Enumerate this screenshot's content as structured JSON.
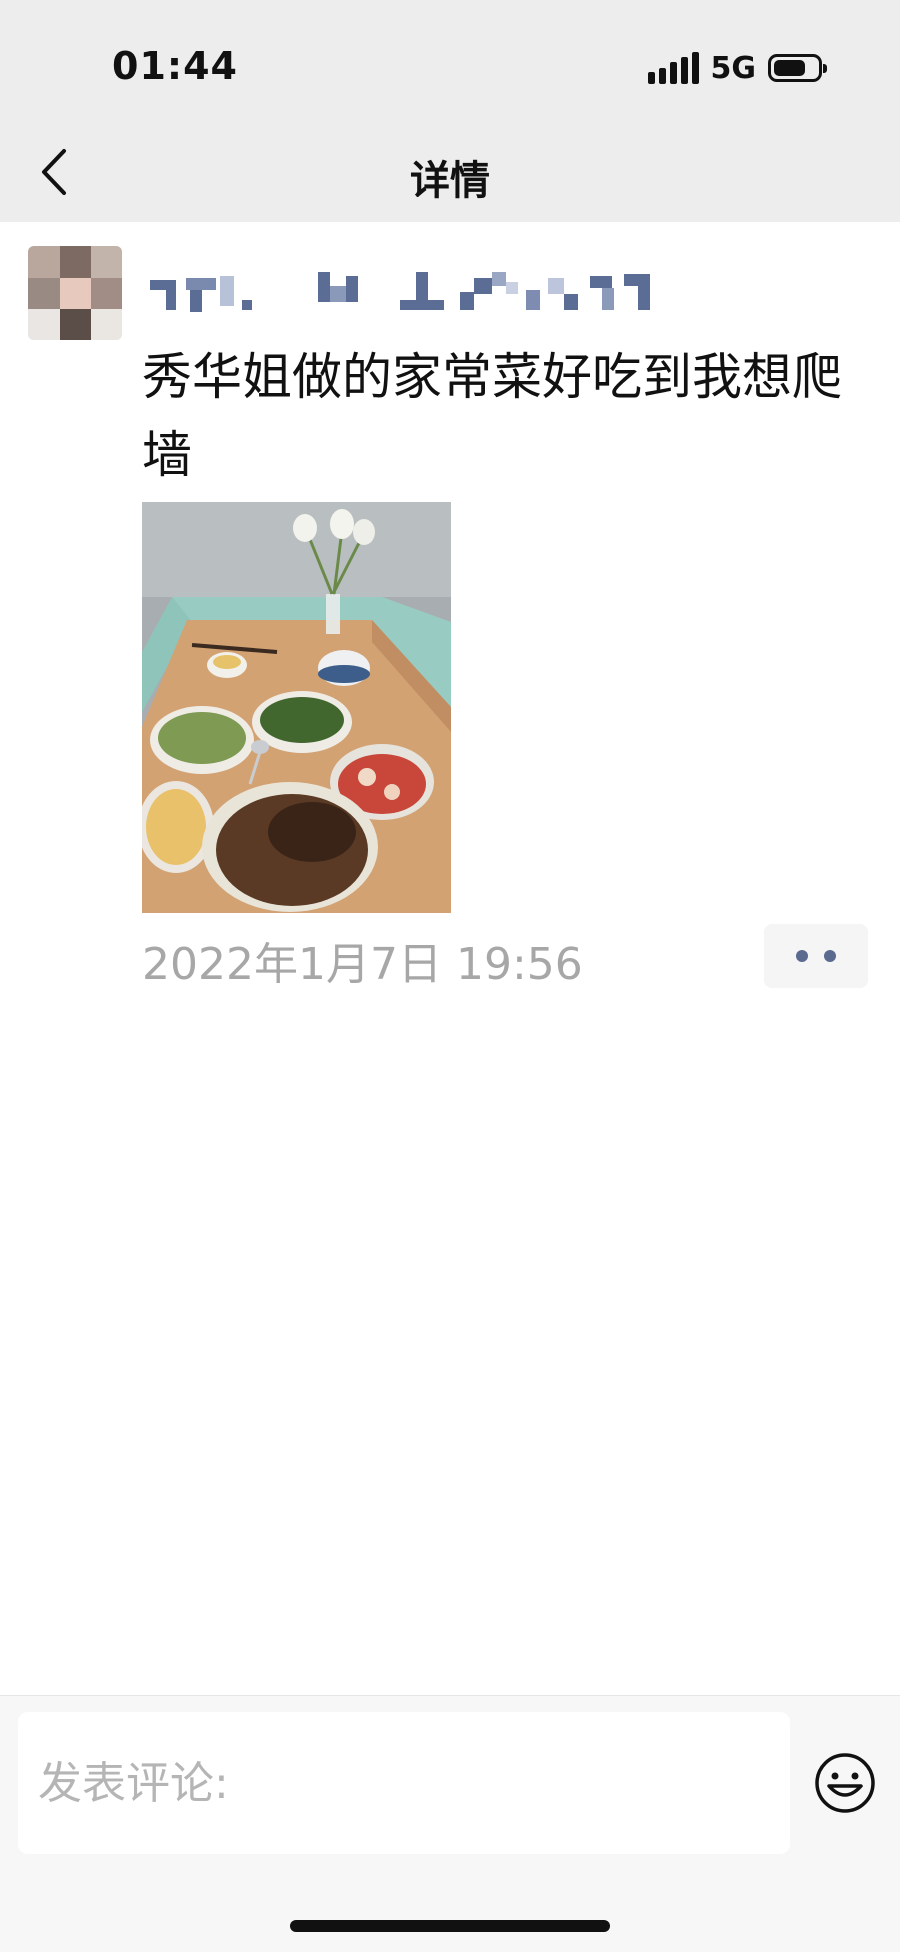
{
  "status_bar": {
    "time": "01:44",
    "network": "5G"
  },
  "nav": {
    "title": "详情"
  },
  "post": {
    "text": "秀华姐做的家常菜好吃到我想爬墙",
    "timestamp": "2022年1月7日 19:56"
  },
  "icons": {
    "back": "chevron-left-icon",
    "more": "more-dots-icon",
    "emoji": "smiley-face-icon",
    "signal": "signal-bars-icon",
    "battery": "battery-icon"
  },
  "comment": {
    "placeholder": "发表评论:"
  },
  "colors": {
    "accent": "#5a6b8f",
    "topbar": "#ededed",
    "timestamp": "#a7a7a7"
  }
}
